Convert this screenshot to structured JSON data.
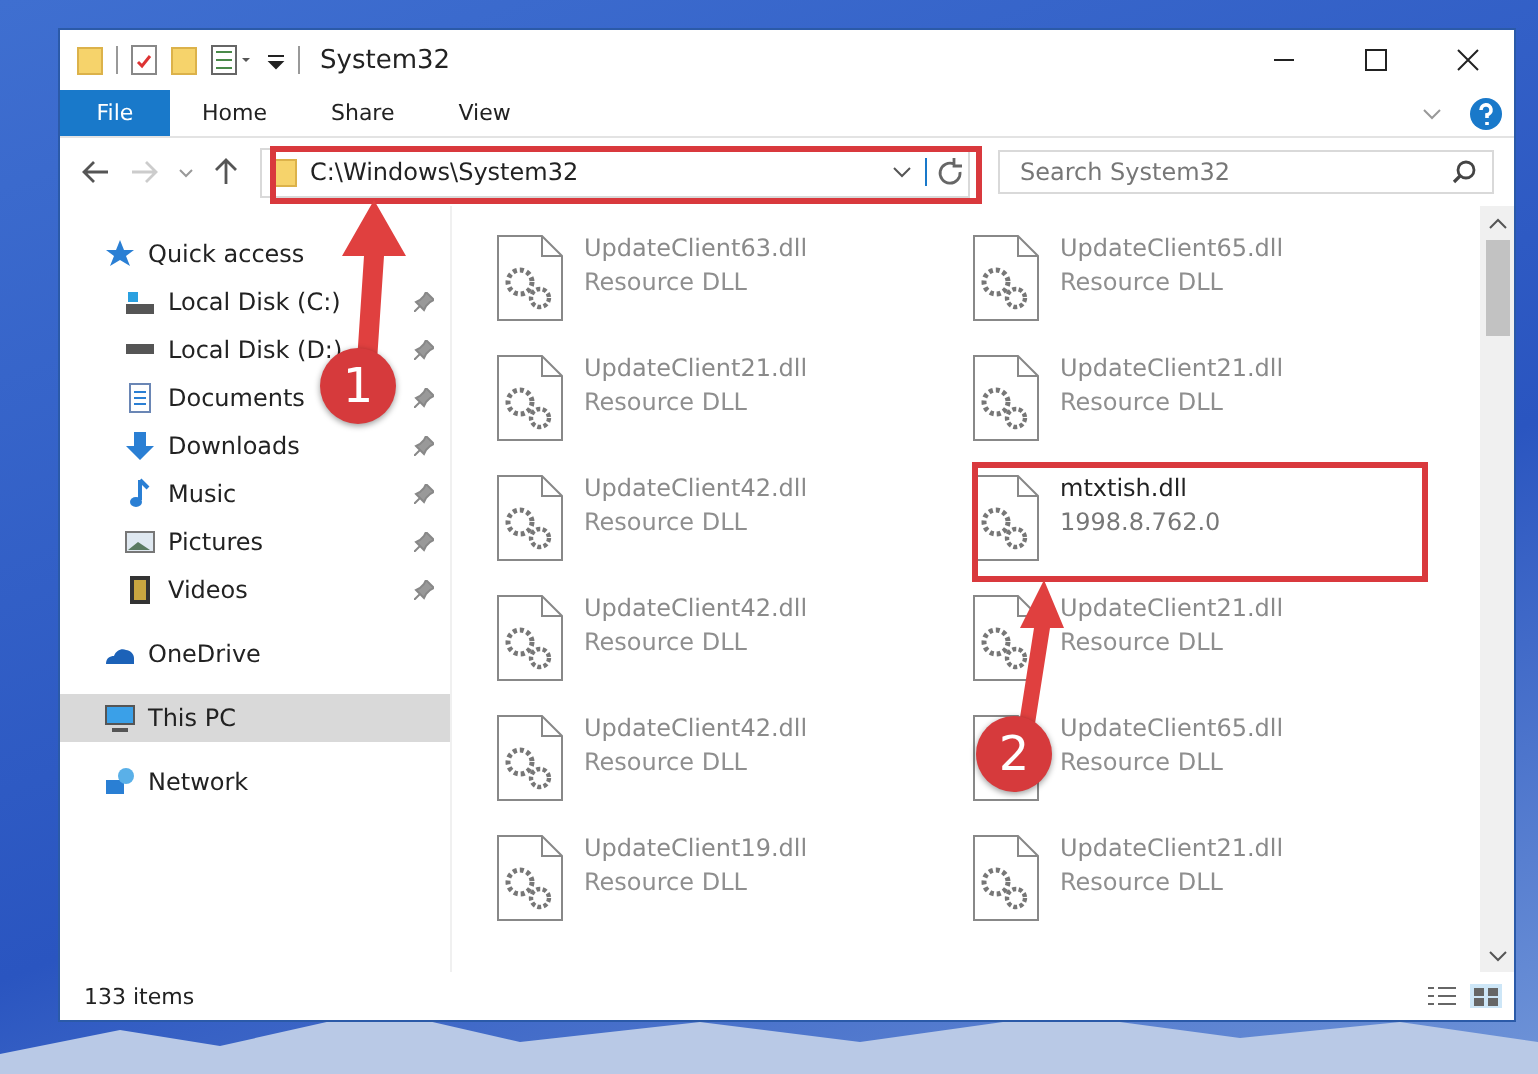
{
  "window": {
    "title": "System32"
  },
  "ribbon": {
    "tabs": [
      {
        "label": "File",
        "selected": true
      },
      {
        "label": "Home",
        "selected": false
      },
      {
        "label": "Share",
        "selected": false
      },
      {
        "label": "View",
        "selected": false
      }
    ]
  },
  "address": {
    "path": "C:\\Windows\\System32"
  },
  "search": {
    "placeholder": "Search System32"
  },
  "sidebar": {
    "items": [
      {
        "label": "Quick access",
        "kind": "quick",
        "selected": false,
        "children": [
          {
            "label": "Local Disk (C:)",
            "kind": "drive-c",
            "pinned": true,
            "selected": false
          },
          {
            "label": "Local Disk (D:)",
            "kind": "drive",
            "pinned": true,
            "selected": false
          },
          {
            "label": "Documents",
            "kind": "documents",
            "pinned": true,
            "selected": false
          },
          {
            "label": "Downloads",
            "kind": "downloads",
            "pinned": true,
            "selected": false
          },
          {
            "label": "Music",
            "kind": "music",
            "pinned": true,
            "selected": false
          },
          {
            "label": "Pictures",
            "kind": "pictures",
            "pinned": true,
            "selected": false
          },
          {
            "label": "Videos",
            "kind": "videos",
            "pinned": true,
            "selected": false
          }
        ]
      },
      {
        "label": "OneDrive",
        "kind": "onedrive",
        "selected": false
      },
      {
        "label": "This PC",
        "kind": "pc",
        "selected": true
      },
      {
        "label": "Network",
        "kind": "network",
        "selected": false
      }
    ]
  },
  "files": [
    {
      "name": "UpdateClient63.dll",
      "detail": "Resource DLL",
      "blurred": true
    },
    {
      "name": "UpdateClient65.dll",
      "detail": "Resource DLL",
      "blurred": true
    },
    {
      "name": "UpdateClient21.dll",
      "detail": "Resource DLL",
      "blurred": true
    },
    {
      "name": "UpdateClient21.dll",
      "detail": "Resource DLL",
      "blurred": true
    },
    {
      "name": "UpdateClient42.dll",
      "detail": "Resource DLL",
      "blurred": true
    },
    {
      "name": "mtxtish.dll",
      "detail": "1998.8.762.0",
      "blurred": false
    },
    {
      "name": "UpdateClient42.dll",
      "detail": "Resource DLL",
      "blurred": true
    },
    {
      "name": "UpdateClient21.dll",
      "detail": "Resource DLL",
      "blurred": true
    },
    {
      "name": "UpdateClient42.dll",
      "detail": "Resource DLL",
      "blurred": true
    },
    {
      "name": "UpdateClient65.dll",
      "detail": "Resource DLL",
      "blurred": true
    },
    {
      "name": "UpdateClient19.dll",
      "detail": "Resource DLL",
      "blurred": true
    },
    {
      "name": "UpdateClient21.dll",
      "detail": "Resource DLL",
      "blurred": true
    }
  ],
  "status_bar": {
    "count": "133 items"
  },
  "callouts": [
    {
      "label": "1"
    },
    {
      "label": "2"
    }
  ]
}
